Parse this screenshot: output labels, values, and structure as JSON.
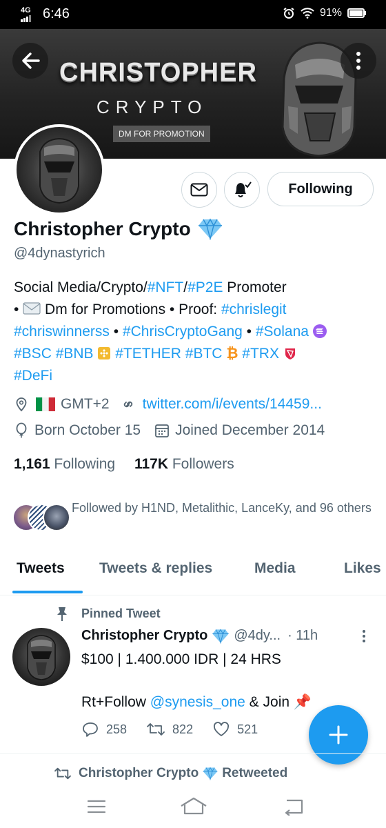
{
  "status_bar": {
    "network": "4G",
    "time": "6:46",
    "battery": "91%"
  },
  "banner": {
    "title": "CHRISTOPHER",
    "subtitle": "CRYPTO",
    "tag": "DM FOR PROMOTION"
  },
  "profile": {
    "name": "Christopher Crypto",
    "handle": "@4dynastyrich",
    "follow_button": "Following",
    "bio": {
      "line1_prefix": "Social Media/Crypto/",
      "tag_nft": "#NFT",
      "slash": "/",
      "tag_p2e": "#P2E",
      "line1_suffix": " Promoter",
      "bullet": "• ",
      "dm_text": " Dm for Promotions • Proof: ",
      "tag_chrislegit": "#chrislegit",
      "tag_chriswinnerss": "#chriswinnerss",
      "sep": " • ",
      "tag_chriscryptogang": "#ChrisCryptoGang",
      "tag_solana": "#Solana",
      "tag_bsc": "#BSC",
      "tag_bnb": "#BNB",
      "tag_tether": "#TETHER",
      "tag_btc": "#BTC",
      "tag_trx": "#TRX",
      "tag_defi": "#DeFi"
    },
    "location": "GMT+2",
    "link": "twitter.com/i/events/14459...",
    "born": "Born October 15",
    "joined": "Joined December 2014",
    "following_count": "1,161",
    "following_label": "Following",
    "followers_count": "117K",
    "followers_label": "Followers",
    "followed_by": "Followed by H1ND, Metalithic, LanceKy, and 96 others"
  },
  "tabs": [
    "Tweets",
    "Tweets & replies",
    "Media",
    "Likes"
  ],
  "tweet": {
    "pinned_label": "Pinned Tweet",
    "author": "Christopher Crypto",
    "handle": "@4dy...",
    "time": "· 11h",
    "line1": "$100 | 1.400.000 IDR | 24 HRS",
    "line2_prefix": "Rt+Follow ",
    "mention": "@synesis_one",
    "line2_suffix": " & Join",
    "replies": "258",
    "retweets": "822",
    "likes": "521"
  },
  "next_item": {
    "retweet_label": "Christopher Crypto",
    "retweet_suffix": "Retweeted"
  },
  "colors": {
    "accent": "#1d9bf0",
    "text": "#0f1419",
    "secondary": "#536471"
  }
}
